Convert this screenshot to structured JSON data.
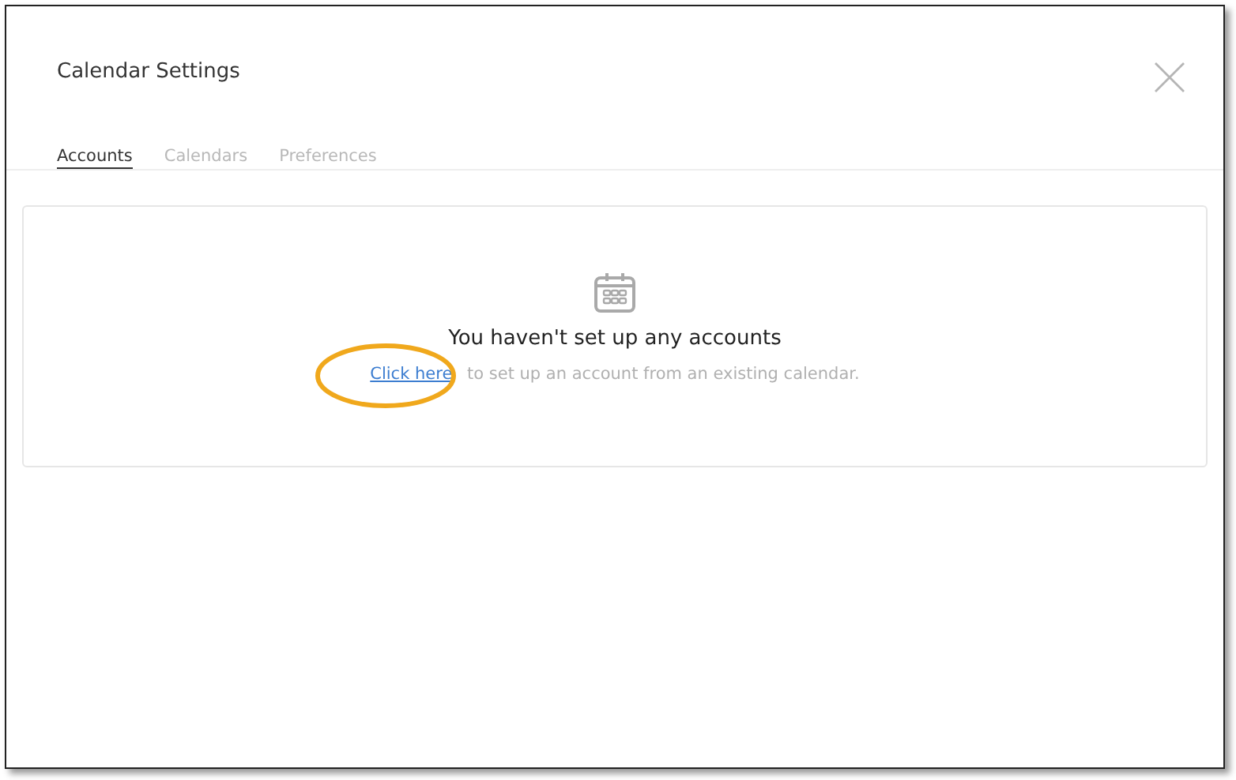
{
  "window": {
    "title": "Calendar Settings"
  },
  "tabs": [
    {
      "label": "Accounts",
      "selected": true
    },
    {
      "label": "Calendars",
      "selected": false
    },
    {
      "label": "Preferences",
      "selected": false
    }
  ],
  "empty_state": {
    "heading": "You haven't set up any accounts",
    "link": "Click here",
    "text": " to set up an account from an existing calendar.",
    "highlighted": true
  }
}
